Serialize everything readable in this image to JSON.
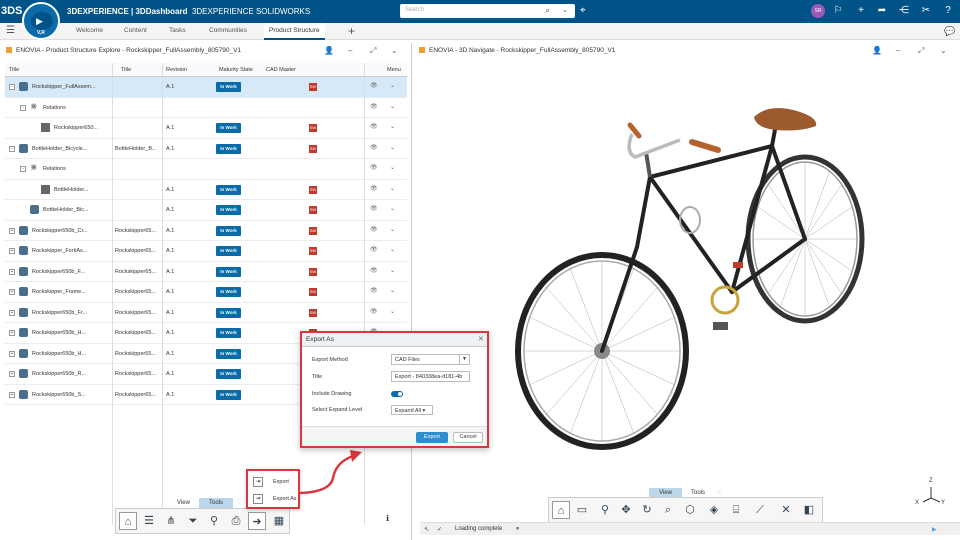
{
  "topbar": {
    "logo": "3DS",
    "compass_label": "V,R",
    "brand_bold": "3DEXPERIENCE | 3DDashboard",
    "brand_thin": "3DEXPERIENCE SOLIDWORKS",
    "search_placeholder": "Search",
    "user_initials": "SR"
  },
  "tabs": [
    "Welcome",
    "Content",
    "Tasks",
    "Communities",
    "Product Structure"
  ],
  "left_panel": {
    "title": "ENOVIA - Product Structure Explore - Rockskipper_FullAssembly_805790_V1"
  },
  "right_panel": {
    "title": "ENOVIA - 3D Navigate - Rockskipper_FullAssembly_805790_V1"
  },
  "grid": {
    "columns": [
      "Title",
      "Title",
      "Revision",
      "Maturity State",
      "CAD Master",
      "Menu"
    ],
    "rows": [
      {
        "title": "Rockskipper_FullAssem...",
        "title2": "",
        "rev": "A.1",
        "state": "In Work",
        "cad": true,
        "sel": true,
        "indent": 0,
        "exp": "-",
        "icon": "part"
      },
      {
        "title": "Relations",
        "title2": "",
        "rev": "",
        "state": "",
        "cad": false,
        "indent": 1,
        "exp": "-",
        "icon": "rel"
      },
      {
        "title": "Rockskipper650...",
        "title2": "",
        "rev": "A.1",
        "state": "In Work",
        "cad": true,
        "indent": 2,
        "exp": "",
        "icon": "draw"
      },
      {
        "title": "BottleHolder_Bicycle...",
        "title2": "BottleHolder_B...",
        "rev": "A.1",
        "state": "In Work",
        "cad": true,
        "indent": 0,
        "exp": "-",
        "icon": "part"
      },
      {
        "title": "Relations",
        "title2": "",
        "rev": "",
        "state": "",
        "cad": false,
        "indent": 1,
        "exp": "-",
        "icon": "rel"
      },
      {
        "title": "BottleHolder...",
        "title2": "",
        "rev": "A.1",
        "state": "In Work",
        "cad": true,
        "indent": 2,
        "exp": "",
        "icon": "draw"
      },
      {
        "title": "BottleHolder_Bic...",
        "title2": "",
        "rev": "A.1",
        "state": "In Work",
        "cad": true,
        "indent": 1,
        "exp": "",
        "icon": "part"
      },
      {
        "title": "Rockskipper650b_Cr...",
        "title2": "Rockskipper65...",
        "rev": "A.1",
        "state": "In Work",
        "cad": true,
        "indent": 0,
        "exp": "+",
        "icon": "part"
      },
      {
        "title": "Rockskipper_ForkAs...",
        "title2": "Rockskipper65...",
        "rev": "A.1",
        "state": "In Work",
        "cad": true,
        "indent": 0,
        "exp": "+",
        "icon": "part"
      },
      {
        "title": "Rockskipper650b_F...",
        "title2": "Rockskipper65...",
        "rev": "A.1",
        "state": "In Work",
        "cad": true,
        "indent": 0,
        "exp": "+",
        "icon": "part"
      },
      {
        "title": "Rockskipper_Frame...",
        "title2": "Rockskipper65...",
        "rev": "A.1",
        "state": "In Work",
        "cad": true,
        "indent": 0,
        "exp": "+",
        "icon": "part"
      },
      {
        "title": "Rockskipper650b_Fr...",
        "title2": "Rockskipper65...",
        "rev": "A.1",
        "state": "In Work",
        "cad": true,
        "indent": 0,
        "exp": "+",
        "icon": "part"
      },
      {
        "title": "Rockskipper650b_H...",
        "title2": "Rockskipper65...",
        "rev": "A.1",
        "state": "In Work",
        "cad": true,
        "indent": 0,
        "exp": "+",
        "icon": "part"
      },
      {
        "title": "Rockskipper650b_H...",
        "title2": "Rockskipper65...",
        "rev": "A.1",
        "state": "In Work",
        "cad": true,
        "indent": 0,
        "exp": "+",
        "icon": "part"
      },
      {
        "title": "Rockskipper650b_R...",
        "title2": "Rockskipper65...",
        "rev": "A.1",
        "state": "In Work",
        "cad": true,
        "indent": 0,
        "exp": "+",
        "icon": "part"
      },
      {
        "title": "Rockskipper650b_S...",
        "title2": "Rockskipper65...",
        "rev": "A.1",
        "state": "In Work",
        "cad": true,
        "indent": 0,
        "exp": "+",
        "icon": "part"
      }
    ]
  },
  "export_dialog": {
    "title": "Export As",
    "method_label": "Export Method",
    "method_value": "CAD Files",
    "title_label": "Title",
    "title_value": "Export - 840338ea-d181-4b",
    "drawing_label": "Include Drawing",
    "expand_label": "Select Expand Level",
    "expand_value": "Expand All",
    "export_btn": "Export",
    "cancel_btn": "Cancel"
  },
  "popup_menu": [
    "Export",
    "Export As"
  ],
  "view_tools_left": {
    "view": "View",
    "tools": "Tools"
  },
  "view_tools_right": {
    "view": "View",
    "tools": "Tools"
  },
  "status": {
    "text": "Loading complete"
  },
  "axes": {
    "z": "Z",
    "y": "Y",
    "x": "X"
  },
  "colors": {
    "topbar": "#005386",
    "badge": "#0b6aa8",
    "highlight": "#d9363e"
  }
}
